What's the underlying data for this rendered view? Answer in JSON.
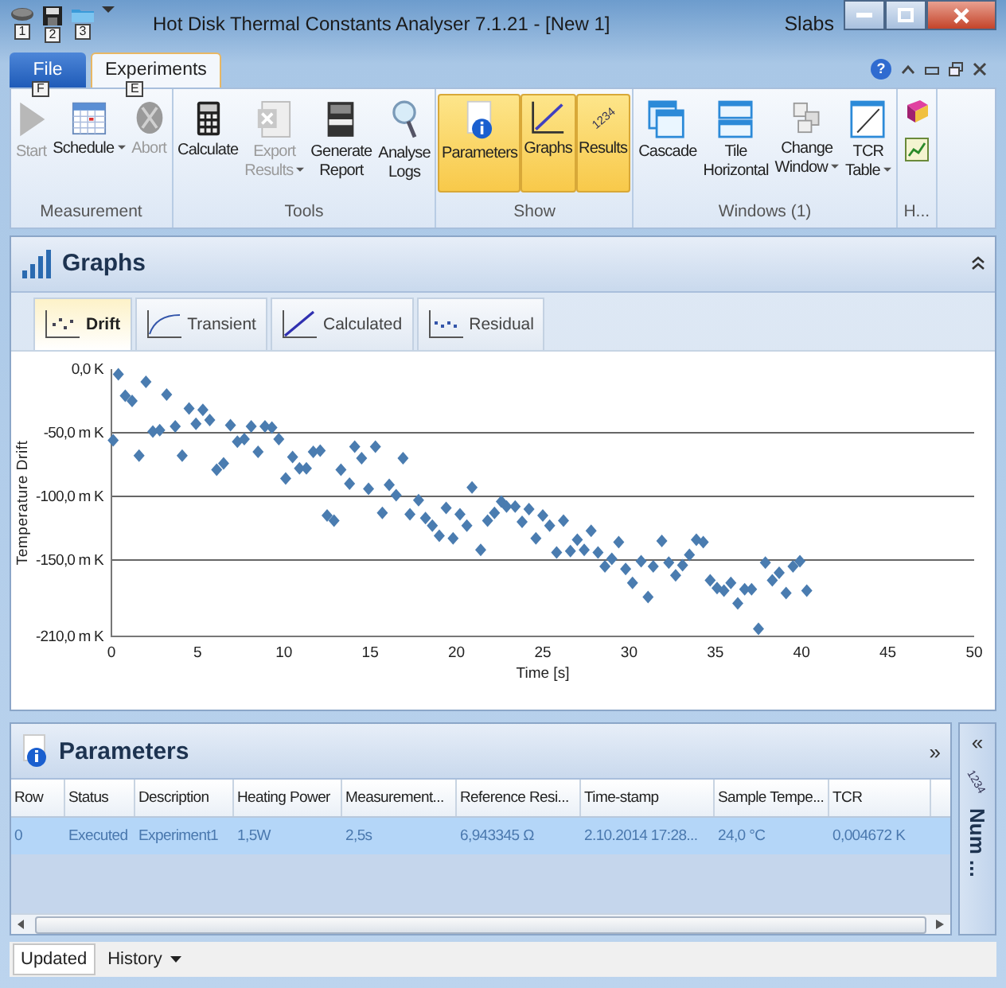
{
  "window": {
    "title": "Hot Disk Thermal Constants Analyser 7.1.21 - [New 1]",
    "user": "Slabs"
  },
  "quick_access": [
    {
      "keytip": "1"
    },
    {
      "keytip": "2"
    },
    {
      "keytip": "3"
    }
  ],
  "ribbon_tabs": [
    {
      "label": "File",
      "kind": "file",
      "keytip": "F",
      "selected": false
    },
    {
      "label": "Experiments",
      "kind": "tab",
      "keytip": "E",
      "selected": true
    }
  ],
  "help": "?",
  "ribbon_groups": [
    {
      "label": "Measurement",
      "buttons": [
        {
          "lines": [
            "Start"
          ],
          "disabled": true,
          "dropdown": false,
          "selected": false
        },
        {
          "lines": [
            "Schedule"
          ],
          "disabled": false,
          "dropdown": true,
          "selected": false
        },
        {
          "lines": [
            "Abort"
          ],
          "disabled": true,
          "dropdown": false,
          "selected": false
        }
      ]
    },
    {
      "label": "Tools",
      "buttons": [
        {
          "lines": [
            "Calculate"
          ],
          "disabled": false,
          "dropdown": false,
          "selected": false
        },
        {
          "lines": [
            "Export",
            "Results"
          ],
          "disabled": true,
          "dropdown": true,
          "selected": false
        },
        {
          "lines": [
            "Generate",
            "Report"
          ],
          "disabled": false,
          "dropdown": false,
          "selected": false
        },
        {
          "lines": [
            "Analyse",
            "Logs"
          ],
          "disabled": false,
          "dropdown": false,
          "selected": false
        }
      ]
    },
    {
      "label": "Show",
      "buttons": [
        {
          "lines": [
            "Parameters"
          ],
          "disabled": false,
          "dropdown": false,
          "selected": true
        },
        {
          "lines": [
            "Graphs"
          ],
          "disabled": false,
          "dropdown": false,
          "selected": true
        },
        {
          "lines": [
            "Results"
          ],
          "icon_text": "1234",
          "disabled": false,
          "dropdown": false,
          "selected": true
        }
      ]
    },
    {
      "label": "Windows (1)",
      "buttons": [
        {
          "lines": [
            "Cascade"
          ],
          "disabled": false,
          "dropdown": false,
          "selected": false
        },
        {
          "lines": [
            "Tile",
            "Horizontal"
          ],
          "disabled": false,
          "dropdown": false,
          "selected": false
        },
        {
          "lines": [
            "Change",
            "Window"
          ],
          "disabled": false,
          "dropdown": true,
          "selected": false
        },
        {
          "lines": [
            "TCR",
            "Table"
          ],
          "disabled": false,
          "dropdown": true,
          "selected": false
        }
      ]
    },
    {
      "label": "H...",
      "buttons": [
        {
          "disabled": false,
          "selected": false
        },
        {
          "disabled": false,
          "selected": false
        }
      ]
    }
  ],
  "graphs_panel": {
    "title": "Graphs",
    "tabs": [
      {
        "label": "Drift",
        "selected": true
      },
      {
        "label": "Transient",
        "selected": false
      },
      {
        "label": "Calculated",
        "selected": false
      },
      {
        "label": "Residual",
        "selected": false
      }
    ],
    "chart_data": {
      "type": "scatter",
      "xlabel": "Time [s]",
      "ylabel": "Temperature Drift",
      "xlim": [
        0,
        50
      ],
      "ylim": [
        -210,
        0
      ],
      "grid": true,
      "xticks": [
        0,
        5,
        10,
        15,
        20,
        25,
        30,
        35,
        40,
        45,
        50
      ],
      "yticks": [
        {
          "value": 0,
          "label": "0,0 K"
        },
        {
          "value": -50,
          "label": "-50,0 m K"
        },
        {
          "value": -100,
          "label": "-100,0 m K"
        },
        {
          "value": -150,
          "label": "-150,0 m K"
        },
        {
          "value": -210,
          "label": "-210,0 m K"
        }
      ],
      "x": [
        0.1,
        0.4,
        0.8,
        1.2,
        1.6,
        2.0,
        2.4,
        2.8,
        3.2,
        3.7,
        4.1,
        4.5,
        4.9,
        5.3,
        5.7,
        6.1,
        6.5,
        6.9,
        7.3,
        7.7,
        8.1,
        8.5,
        8.9,
        9.3,
        9.7,
        10.1,
        10.5,
        10.9,
        11.3,
        11.7,
        12.1,
        12.5,
        12.9,
        13.3,
        13.8,
        14.1,
        14.5,
        14.9,
        15.3,
        15.7,
        16.1,
        16.5,
        16.9,
        17.3,
        17.8,
        18.2,
        18.6,
        19.0,
        19.4,
        19.8,
        20.2,
        20.6,
        20.9,
        21.4,
        21.8,
        22.2,
        22.6,
        22.9,
        23.4,
        23.8,
        24.2,
        24.6,
        25.0,
        25.4,
        25.8,
        26.2,
        26.6,
        27.0,
        27.4,
        27.8,
        28.2,
        28.6,
        29.0,
        29.4,
        29.8,
        30.2,
        30.7,
        31.1,
        31.4,
        31.9,
        32.3,
        32.7,
        33.1,
        33.5,
        33.9,
        34.3,
        34.7,
        35.1,
        35.5,
        35.9,
        36.3,
        36.7,
        37.1,
        37.5,
        37.9,
        38.3,
        38.7,
        39.1,
        39.5,
        39.9,
        40.3
      ],
      "series": [
        {
          "color": "#4a7cb0",
          "values": [
            -56,
            -4,
            -21,
            -25,
            -68,
            -10,
            -49,
            -48,
            -20,
            -45,
            -68,
            -31,
            -43,
            -32,
            -40,
            -79,
            -74,
            -44,
            -57,
            -55,
            -45,
            -65,
            -45,
            -46,
            -55,
            -86,
            -69,
            -78,
            -78,
            -65,
            -64,
            -115,
            -119,
            -79,
            -90,
            -61,
            -70,
            -94,
            -61,
            -113,
            -91,
            -99,
            -70,
            -114,
            -103,
            -117,
            -123,
            -131,
            -109,
            -133,
            -114,
            -123,
            -93,
            -142,
            -119,
            -113,
            -104,
            -108,
            -108,
            -120,
            -110,
            -133,
            -115,
            -123,
            -144,
            -119,
            -143,
            -134,
            -142,
            -127,
            -144,
            -155,
            -149,
            -136,
            -157,
            -168,
            -151,
            -179,
            -155,
            -135,
            -152,
            -162,
            -154,
            -146,
            -134,
            -136,
            -166,
            -172,
            -174,
            -168,
            -184,
            -173,
            -173,
            -204,
            -152,
            -166,
            -160,
            -176,
            -155,
            -151,
            -174
          ]
        }
      ]
    }
  },
  "parameters_panel": {
    "title": "Parameters",
    "expand": "»",
    "columns": [
      "Row",
      "Status",
      "Description",
      "Heating Power",
      "Measurement...",
      "Reference Resi...",
      "Time-stamp",
      "Sample Tempe...",
      "TCR"
    ],
    "rows": [
      {
        "selected": true,
        "cells": [
          "0",
          "Executed",
          "Experiment1",
          "1,5W",
          "2,5s",
          "6,943345 Ω",
          "2.10.2014 17:28...",
          "24,0 °C",
          "0,004672 K"
        ]
      }
    ]
  },
  "side_panel": {
    "collapse": "«",
    "icon_text": "1234",
    "title": "Num ..."
  },
  "status_bar": [
    {
      "label": "Updated",
      "selected": true,
      "dropdown": false
    },
    {
      "label": "History",
      "selected": false,
      "dropdown": true
    }
  ]
}
